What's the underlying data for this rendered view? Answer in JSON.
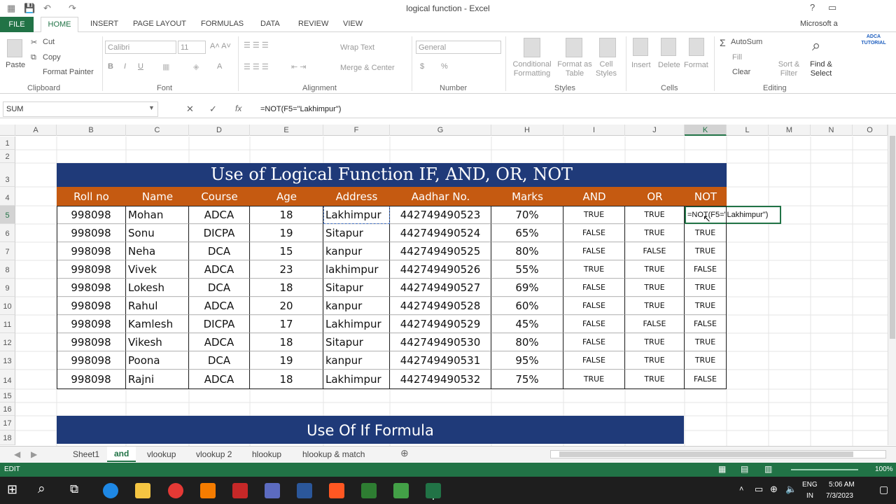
{
  "window": {
    "title": "logical function - Excel",
    "help": "?",
    "account": "Microsoft a"
  },
  "menu": {
    "file": "FILE",
    "tabs": [
      "HOME",
      "INSERT",
      "PAGE LAYOUT",
      "FORMULAS",
      "DATA",
      "REVIEW",
      "VIEW"
    ]
  },
  "ribbon": {
    "clipboard": {
      "paste": "Paste",
      "cut": "Cut",
      "copy": "Copy",
      "format_painter": "Format Painter",
      "group": "Clipboard"
    },
    "font": {
      "name": "Calibri",
      "size": "11",
      "group": "Font"
    },
    "alignment": {
      "wrap": "Wrap Text",
      "merge": "Merge & Center",
      "group": "Alignment"
    },
    "number": {
      "format": "General",
      "currency": "$",
      "percent": "%",
      "group": "Number"
    },
    "styles": {
      "conditional": "Conditional Formatting",
      "format_table": "Format as Table",
      "cell_styles": "Cell Styles",
      "group": "Styles"
    },
    "cells": {
      "insert": "Insert",
      "delete": "Delete",
      "format": "Format",
      "group": "Cells"
    },
    "editing": {
      "autosum": "AutoSum",
      "fill": "Fill",
      "clear": "Clear",
      "sort": "Sort & Filter",
      "find": "Find & Select",
      "group": "Editing"
    },
    "watermark": "ADCA TUTORIAL"
  },
  "formula_bar": {
    "name_box": "SUM",
    "fx": "fx",
    "formula": "=NOT(F5=\"Lakhimpur\")"
  },
  "columns": [
    "A",
    "B",
    "C",
    "D",
    "E",
    "F",
    "G",
    "H",
    "I",
    "J",
    "K",
    "L",
    "M",
    "N",
    "O"
  ],
  "rows": [
    "1",
    "2",
    "3",
    "4",
    "5",
    "6",
    "7",
    "8",
    "9",
    "10",
    "11",
    "12",
    "13",
    "14",
    "15",
    "16",
    "17",
    "18"
  ],
  "sheet": {
    "banner_title": "Use of Logical Function IF, AND, OR, NOT",
    "headers": [
      "Roll no",
      "Name",
      "Course",
      "Age",
      "Address",
      "Aadhar No.",
      "Marks",
      "AND",
      "OR",
      "NOT"
    ],
    "records": [
      [
        "998098",
        "Mohan",
        "ADCA",
        "18",
        "Lakhimpur",
        "442749490523",
        "70%",
        "TRUE",
        "TRUE",
        "=NOT(F5=\"Lakhimpur\")"
      ],
      [
        "998098",
        "Sonu",
        "DICPA",
        "19",
        "Sitapur",
        "442749490524",
        "65%",
        "FALSE",
        "TRUE",
        "TRUE"
      ],
      [
        "998098",
        "Neha",
        "DCA",
        "15",
        "kanpur",
        "442749490525",
        "80%",
        "FALSE",
        "FALSE",
        "TRUE"
      ],
      [
        "998098",
        "Vivek",
        "ADCA",
        "23",
        "lakhimpur",
        "442749490526",
        "55%",
        "TRUE",
        "TRUE",
        "FALSE"
      ],
      [
        "998098",
        "Lokesh",
        "DCA",
        "18",
        "Sitapur",
        "442749490527",
        "69%",
        "FALSE",
        "TRUE",
        "TRUE"
      ],
      [
        "998098",
        "Rahul",
        "ADCA",
        "20",
        "kanpur",
        "442749490528",
        "60%",
        "FALSE",
        "TRUE",
        "TRUE"
      ],
      [
        "998098",
        "Kamlesh",
        "DICPA",
        "17",
        "Lakhimpur",
        "442749490529",
        "45%",
        "FALSE",
        "FALSE",
        "FALSE"
      ],
      [
        "998098",
        "Vikesh",
        "ADCA",
        "18",
        "Sitapur",
        "442749490530",
        "80%",
        "FALSE",
        "TRUE",
        "TRUE"
      ],
      [
        "998098",
        "Poona",
        "DCA",
        "19",
        "kanpur",
        "442749490531",
        "95%",
        "FALSE",
        "TRUE",
        "TRUE"
      ],
      [
        "998098",
        "Rajni",
        "ADCA",
        "18",
        "Lakhimpur",
        "442749490532",
        "75%",
        "TRUE",
        "TRUE",
        "FALSE"
      ]
    ],
    "second_banner": "Use Of  If Formula"
  },
  "sheet_tabs": [
    "Sheet1",
    "and",
    "vlookup",
    "vlookup 2",
    "hlookup",
    "hlookup & match"
  ],
  "active_sheet": "and",
  "status": {
    "mode": "EDIT",
    "zoom": "100%"
  },
  "taskbar": {
    "lang": "ENG",
    "region": "IN",
    "time": "5:06 AM",
    "date": "7/3/2023"
  }
}
